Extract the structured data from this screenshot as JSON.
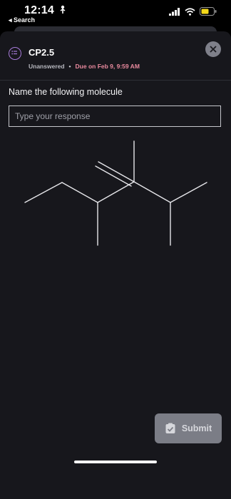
{
  "status_bar": {
    "time": "12:14",
    "back_label": "◂ Search"
  },
  "question": {
    "title": "CP2.5",
    "status": "Unanswered",
    "due": "Due on Feb 9, 9:59 AM",
    "prompt": "Name the following molecule",
    "placeholder": "Type your response"
  },
  "actions": {
    "submit_label": "Submit"
  },
  "colors": {
    "accent_purple": "#a77bd9",
    "due_pink": "#e98a9e",
    "sheet_bg": "#17171c"
  },
  "icons": [
    "location-arrow-icon",
    "signal-icon",
    "wifi-icon",
    "battery-icon",
    "question-icon",
    "close-icon",
    "checklist-icon"
  ]
}
